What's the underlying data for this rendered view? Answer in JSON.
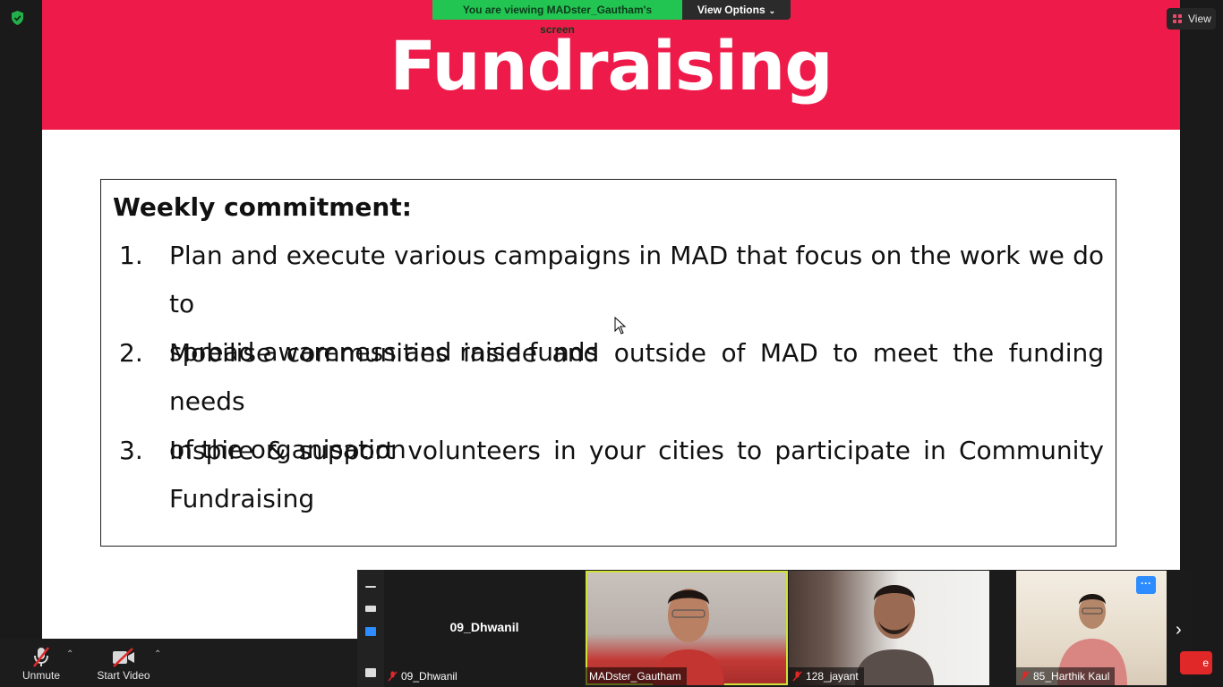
{
  "slide": {
    "title": "Fundraising",
    "box_heading": "Weekly commitment:",
    "items": [
      {
        "num": "1.",
        "line1": "Plan and execute various campaigns in MAD that focus on the work we do to",
        "line2": "spread awareness and raise funds"
      },
      {
        "num": "2.",
        "line1": "Mobilise communities inside and outside of MAD to meet the funding needs",
        "line2": "of the organisation"
      },
      {
        "num": "3.",
        "line1": "Inspire & support volunteers in your cities to participate in Community",
        "line2": "Fundraising"
      }
    ],
    "banner_color": "#ee1b4a"
  },
  "share_bar": {
    "viewing_text": "You are viewing MADster_Gautham's screen",
    "view_options": "View Options"
  },
  "view_button": "View",
  "controls": {
    "unmute_label": "Unmute",
    "start_video_label": "Start Video"
  },
  "participants": [
    {
      "name": "09_Dhwanil",
      "center_label": "09_Dhwanil",
      "muted": true
    },
    {
      "name": "MADster_Gautham",
      "muted": false,
      "active_speaker": true
    },
    {
      "name": "128_jayant",
      "muted": true
    },
    {
      "name": "85_Harthik Kaul",
      "muted": true
    }
  ],
  "end_button_label": "e",
  "icons": [
    "shield-icon",
    "mic-muted-icon",
    "video-off-icon",
    "more-icon",
    "next-arrow-icon",
    "view-grid-icon"
  ]
}
